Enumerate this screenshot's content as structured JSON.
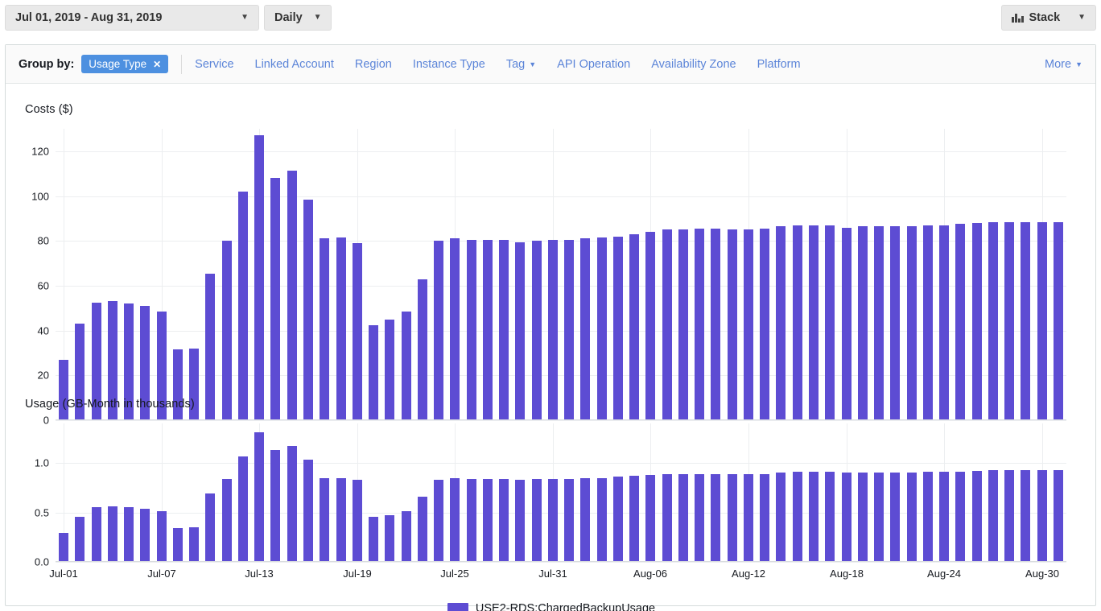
{
  "toolbar": {
    "date_range": "Jul 01, 2019 - Aug 31, 2019",
    "granularity": "Daily",
    "stack": "Stack",
    "caret": "▼",
    "stack_icon": "bar-chart-icon"
  },
  "group_by": {
    "label": "Group by:",
    "selected_pill": "Usage Type",
    "pill_close": "✕",
    "options": [
      {
        "label": "Service",
        "has_caret": false
      },
      {
        "label": "Linked Account",
        "has_caret": false
      },
      {
        "label": "Region",
        "has_caret": false
      },
      {
        "label": "Instance Type",
        "has_caret": false
      },
      {
        "label": "Tag",
        "has_caret": true
      },
      {
        "label": "API Operation",
        "has_caret": false
      },
      {
        "label": "Availability Zone",
        "has_caret": false
      },
      {
        "label": "Platform",
        "has_caret": false
      }
    ],
    "more": "More",
    "caret": "▼"
  },
  "legend": {
    "series_label": "USE2-RDS:ChargedBackupUsage",
    "color": "#5d4cd3"
  },
  "colors": {
    "bar": "#5d4cd3",
    "pill": "#4d90e0",
    "link": "#5b84d8",
    "grid": "#eceef0"
  },
  "chart_data": [
    {
      "type": "bar",
      "title": "Costs ($)",
      "xlabel": "",
      "ylabel": "Costs ($)",
      "ylim": [
        0,
        130
      ],
      "yticks": [
        0,
        20,
        40,
        60,
        80,
        100,
        120
      ],
      "ytick_labels": [
        "0",
        "20",
        "40",
        "60",
        "80",
        "100",
        "120"
      ],
      "grid": true,
      "legend_position": "bottom",
      "categories": [
        "Jul-01",
        "Jul-02",
        "Jul-03",
        "Jul-04",
        "Jul-05",
        "Jul-06",
        "Jul-07",
        "Jul-08",
        "Jul-09",
        "Jul-10",
        "Jul-11",
        "Jul-12",
        "Jul-13",
        "Jul-14",
        "Jul-15",
        "Jul-16",
        "Jul-17",
        "Jul-18",
        "Jul-19",
        "Jul-20",
        "Jul-21",
        "Jul-22",
        "Jul-23",
        "Jul-24",
        "Jul-25",
        "Jul-26",
        "Jul-27",
        "Jul-28",
        "Jul-29",
        "Jul-30",
        "Jul-31",
        "Aug-01",
        "Aug-02",
        "Aug-03",
        "Aug-04",
        "Aug-05",
        "Aug-06",
        "Aug-07",
        "Aug-08",
        "Aug-09",
        "Aug-10",
        "Aug-11",
        "Aug-12",
        "Aug-13",
        "Aug-14",
        "Aug-15",
        "Aug-16",
        "Aug-17",
        "Aug-18",
        "Aug-19",
        "Aug-20",
        "Aug-21",
        "Aug-22",
        "Aug-23",
        "Aug-24",
        "Aug-25",
        "Aug-26",
        "Aug-27",
        "Aug-28",
        "Aug-29",
        "Aug-30",
        "Aug-31"
      ],
      "xtick_labels": [
        "Jul-01",
        "Jul-07",
        "Jul-13",
        "Jul-19",
        "Jul-25",
        "Jul-31",
        "Aug-06",
        "Aug-12",
        "Aug-18",
        "Aug-24",
        "Aug-30"
      ],
      "xtick_indices": [
        0,
        6,
        12,
        18,
        24,
        30,
        36,
        42,
        48,
        54,
        60
      ],
      "series": [
        {
          "name": "USE2-RDS:ChargedBackupUsage",
          "values": [
            27,
            43,
            52.5,
            53,
            52,
            51,
            48.5,
            31.5,
            32,
            65.5,
            80,
            102,
            127,
            108,
            111.5,
            98.5,
            81,
            81.5,
            79,
            42.5,
            45,
            48.5,
            63,
            80,
            81,
            80.5,
            80.5,
            80.5,
            79.5,
            80,
            80.5,
            80.5,
            81,
            81.5,
            82,
            83,
            84,
            85,
            85,
            85.5,
            85.5,
            85,
            85,
            85.5,
            86.5,
            87,
            87,
            87,
            86,
            86.5,
            86.5,
            86.5,
            86.5,
            87,
            87,
            87.5,
            88,
            88.5,
            88.5,
            88.5,
            88.5,
            88.5
          ]
        }
      ]
    },
    {
      "type": "bar",
      "title": "Usage (GB-Month in thousands)",
      "xlabel": "",
      "ylabel": "Usage (GB-Month in thousands)",
      "ylim": [
        0,
        1.4
      ],
      "yticks": [
        0.0,
        0.5,
        1.0
      ],
      "ytick_labels": [
        "0.0",
        "0.5",
        "1.0"
      ],
      "grid": true,
      "legend_position": "bottom",
      "categories": [
        "Jul-01",
        "Jul-02",
        "Jul-03",
        "Jul-04",
        "Jul-05",
        "Jul-06",
        "Jul-07",
        "Jul-08",
        "Jul-09",
        "Jul-10",
        "Jul-11",
        "Jul-12",
        "Jul-13",
        "Jul-14",
        "Jul-15",
        "Jul-16",
        "Jul-17",
        "Jul-18",
        "Jul-19",
        "Jul-20",
        "Jul-21",
        "Jul-22",
        "Jul-23",
        "Jul-24",
        "Jul-25",
        "Jul-26",
        "Jul-27",
        "Jul-28",
        "Jul-29",
        "Jul-30",
        "Jul-31",
        "Aug-01",
        "Aug-02",
        "Aug-03",
        "Aug-04",
        "Aug-05",
        "Aug-06",
        "Aug-07",
        "Aug-08",
        "Aug-09",
        "Aug-10",
        "Aug-11",
        "Aug-12",
        "Aug-13",
        "Aug-14",
        "Aug-15",
        "Aug-16",
        "Aug-17",
        "Aug-18",
        "Aug-19",
        "Aug-20",
        "Aug-21",
        "Aug-22",
        "Aug-23",
        "Aug-24",
        "Aug-25",
        "Aug-26",
        "Aug-27",
        "Aug-28",
        "Aug-29",
        "Aug-30",
        "Aug-31"
      ],
      "xtick_labels": [
        "Jul-01",
        "Jul-07",
        "Jul-13",
        "Jul-19",
        "Jul-25",
        "Jul-31",
        "Aug-06",
        "Aug-12",
        "Aug-18",
        "Aug-24",
        "Aug-30"
      ],
      "xtick_indices": [
        0,
        6,
        12,
        18,
        24,
        30,
        36,
        42,
        48,
        54,
        60
      ],
      "series": [
        {
          "name": "USE2-RDS:ChargedBackupUsage",
          "values": [
            0.29,
            0.46,
            0.55,
            0.56,
            0.55,
            0.54,
            0.51,
            0.34,
            0.35,
            0.69,
            0.84,
            1.07,
            1.31,
            1.13,
            1.17,
            1.03,
            0.85,
            0.85,
            0.83,
            0.46,
            0.47,
            0.51,
            0.66,
            0.83,
            0.85,
            0.84,
            0.84,
            0.84,
            0.83,
            0.84,
            0.84,
            0.84,
            0.85,
            0.85,
            0.86,
            0.87,
            0.88,
            0.89,
            0.89,
            0.89,
            0.89,
            0.89,
            0.89,
            0.89,
            0.9,
            0.91,
            0.91,
            0.91,
            0.9,
            0.9,
            0.9,
            0.9,
            0.9,
            0.91,
            0.91,
            0.91,
            0.92,
            0.93,
            0.93,
            0.93,
            0.93,
            0.93
          ]
        }
      ]
    }
  ]
}
